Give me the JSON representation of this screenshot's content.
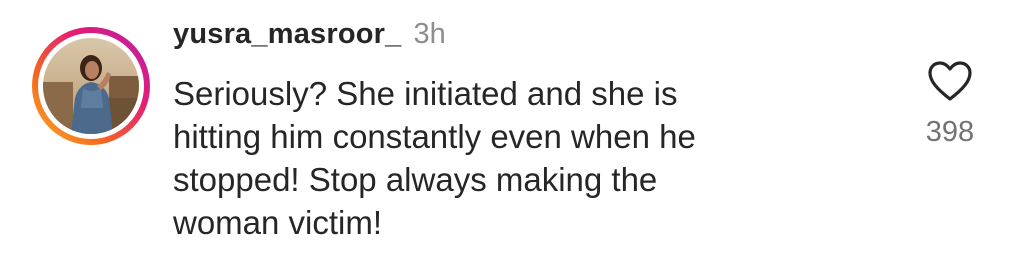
{
  "comment": {
    "username": "yusra_masroor_",
    "time": "3h",
    "text": "Seriously? She initiated and she is\nhitting him constantly even when he\nstopped! Stop always making the\nwoman victim!",
    "likes": "398",
    "icons": {
      "like": "heart-outline-icon"
    }
  },
  "colors": {
    "text": "#262626",
    "secondary": "#8e8e8e",
    "ring_start": "#f9b22a",
    "ring_end": "#b41fb0"
  }
}
